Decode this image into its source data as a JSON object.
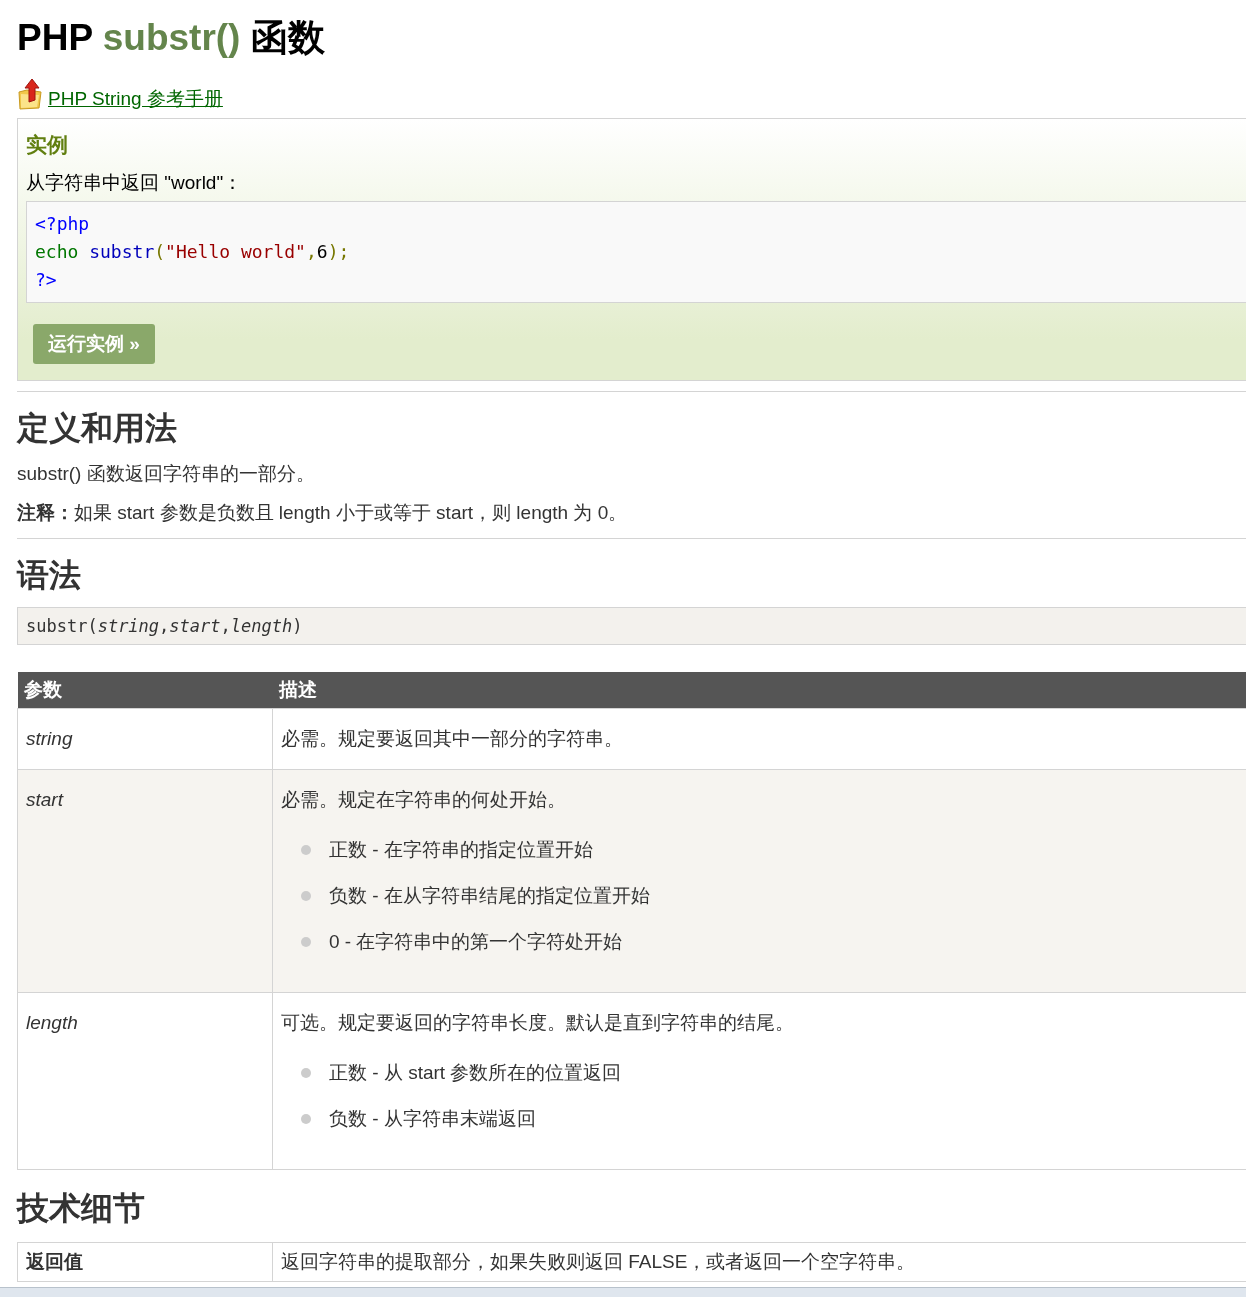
{
  "title": {
    "prefix": "PHP",
    "function": "substr()",
    "suffix": "函数"
  },
  "reference_link": "PHP String 参考手册",
  "example": {
    "heading": "实例",
    "description": "从字符串中返回 \"world\"：",
    "code_lines": [
      [
        {
          "text": "<?php",
          "kind": "tag"
        }
      ],
      [
        {
          "text": "echo",
          "kind": "keyword"
        },
        {
          "text": " substr",
          "kind": "function"
        },
        {
          "text": "(",
          "kind": "paren"
        },
        {
          "text": "\"Hello world\"",
          "kind": "string"
        },
        {
          "text": ",",
          "kind": "punct"
        },
        {
          "text": "6",
          "kind": "number"
        },
        {
          "text": ")",
          "kind": "paren"
        },
        {
          "text": ";",
          "kind": "punct"
        }
      ],
      [
        {
          "text": "?>",
          "kind": "tag"
        }
      ]
    ],
    "run_button": "运行实例 »"
  },
  "sections": [
    {
      "heading": "定义和用法",
      "paragraphs": [
        "substr() 函数返回字符串的一部分。",
        "**注释：**如果 start 参数是负数且 length 小于或等于 start，则 length 为 0。"
      ]
    },
    {
      "heading": "语法",
      "syntax": "substr(*string*,*start*,*length*)"
    }
  ],
  "params_table": {
    "columns": [
      "参数",
      "描述"
    ],
    "rows": [
      {
        "param": "string",
        "description": "必需。规定要返回其中一部分的字符串。"
      },
      {
        "param": "start",
        "description": "必需。规定在字符串的何处开始。",
        "bullets": [
          "正数 - 在字符串的指定位置开始",
          "负数 - 在从字符串结尾的指定位置开始",
          "0 - 在字符串中的第一个字符处开始"
        ]
      },
      {
        "param": "length",
        "description": "可选。规定要返回的字符串长度。默认是直到字符串的结尾。",
        "bullets": [
          "正数 - 从 start 参数所在的位置返回",
          "负数 - 从字符串末端返回"
        ]
      }
    ]
  },
  "tech_details": {
    "heading": "技术细节",
    "rows": [
      {
        "label": "返回值",
        "value": "返回字符串的提取部分，如果失败则返回 FALSE，或者返回一个空字符串。"
      }
    ]
  }
}
